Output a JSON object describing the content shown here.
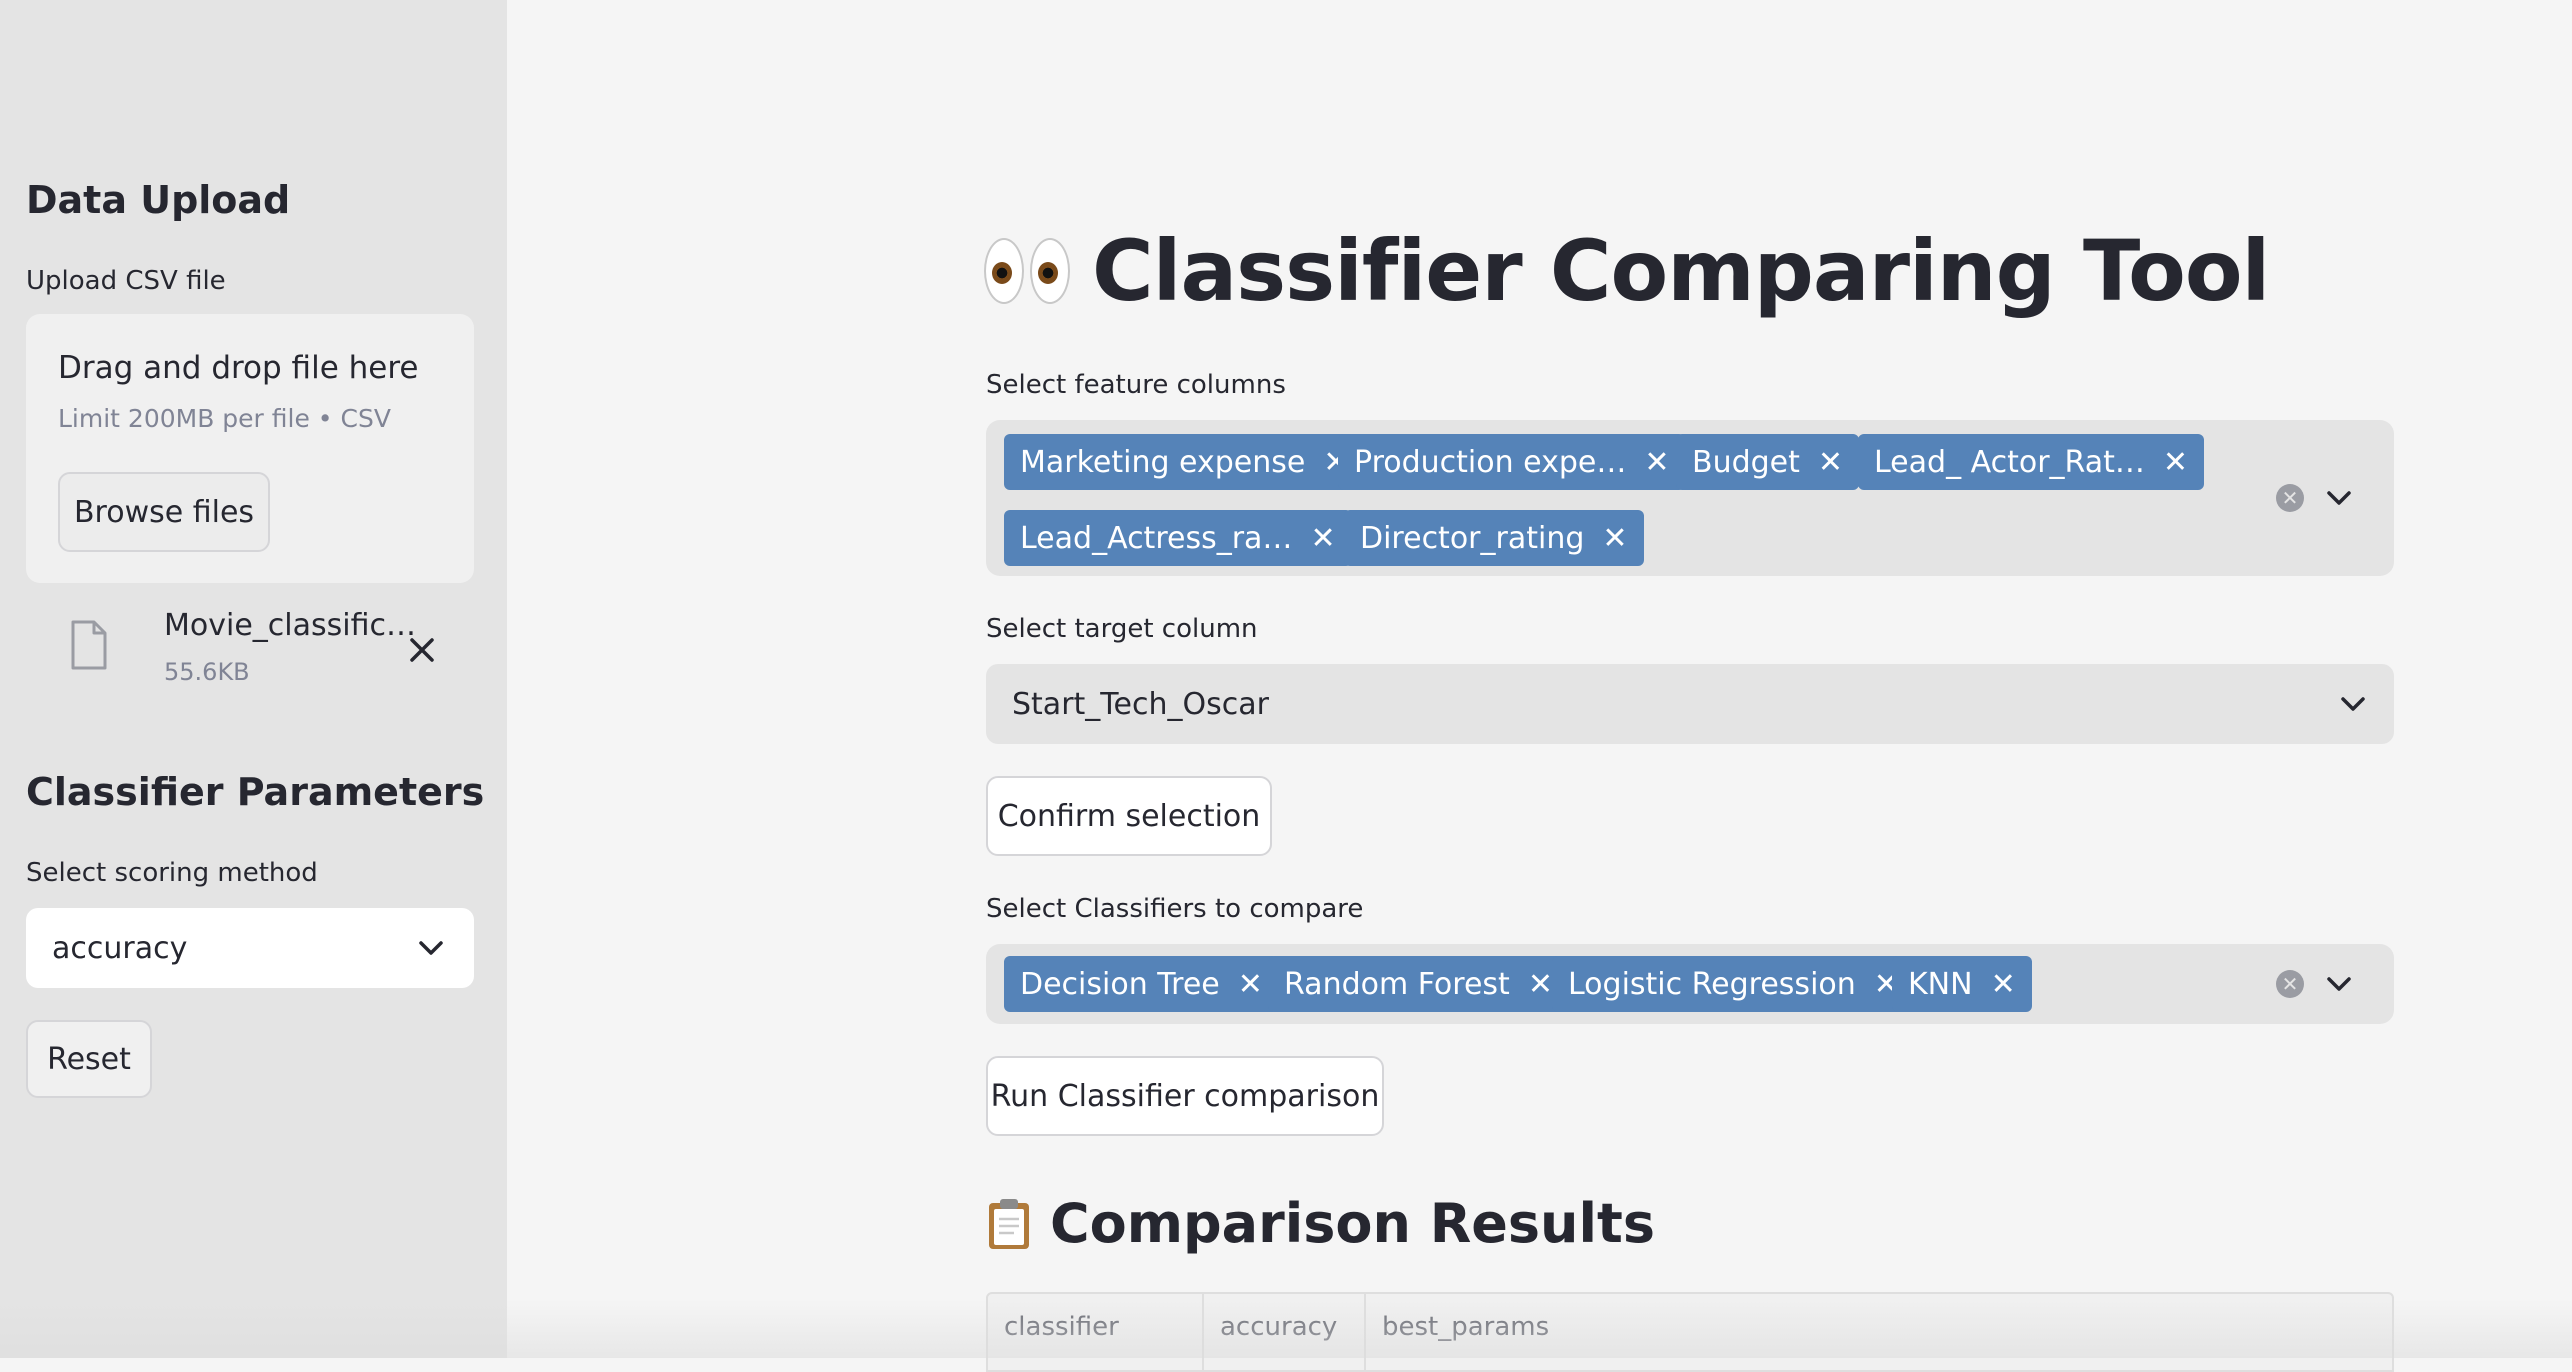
{
  "sidebar": {
    "data_upload_heading": "Data Upload",
    "upload_label": "Upload CSV file",
    "dropzone": {
      "title": "Drag and drop file here",
      "subtitle": "Limit 200MB per file • CSV",
      "browse_label": "Browse files"
    },
    "uploaded_file": {
      "name": "Movie_classific…",
      "size": "55.6KB",
      "icon": "file-icon"
    },
    "classifier_params_heading": "Classifier Parameters",
    "scoring_label": "Select scoring method",
    "scoring_value": "accuracy",
    "reset_label": "Reset"
  },
  "main": {
    "title": "Classifier Comparing Tool",
    "title_icon": "eyes-emoji",
    "feature_label": "Select feature columns",
    "feature_tags": [
      "Marketing expense",
      "Production expe…",
      "Budget",
      "Lead_ Actor_Rat…",
      "Lead_Actress_ra…",
      "Director_rating"
    ],
    "target_label": "Select target column",
    "target_value": "Start_Tech_Oscar",
    "confirm_label": "Confirm selection",
    "classifiers_label": "Select Classifiers to compare",
    "classifier_tags": [
      "Decision Tree",
      "Random Forest",
      "Logistic Regression",
      "KNN"
    ],
    "run_label": "Run Classifier comparison",
    "results_heading": "Comparison Results",
    "results_icon": "clipboard-emoji",
    "table_headers": [
      "classifier",
      "accuracy",
      "best_params"
    ]
  },
  "colors": {
    "sidebar_bg": "#e4e4e4",
    "main_bg": "#f5f5f5",
    "tag_bg": "#5583b8",
    "text": "#262730"
  }
}
